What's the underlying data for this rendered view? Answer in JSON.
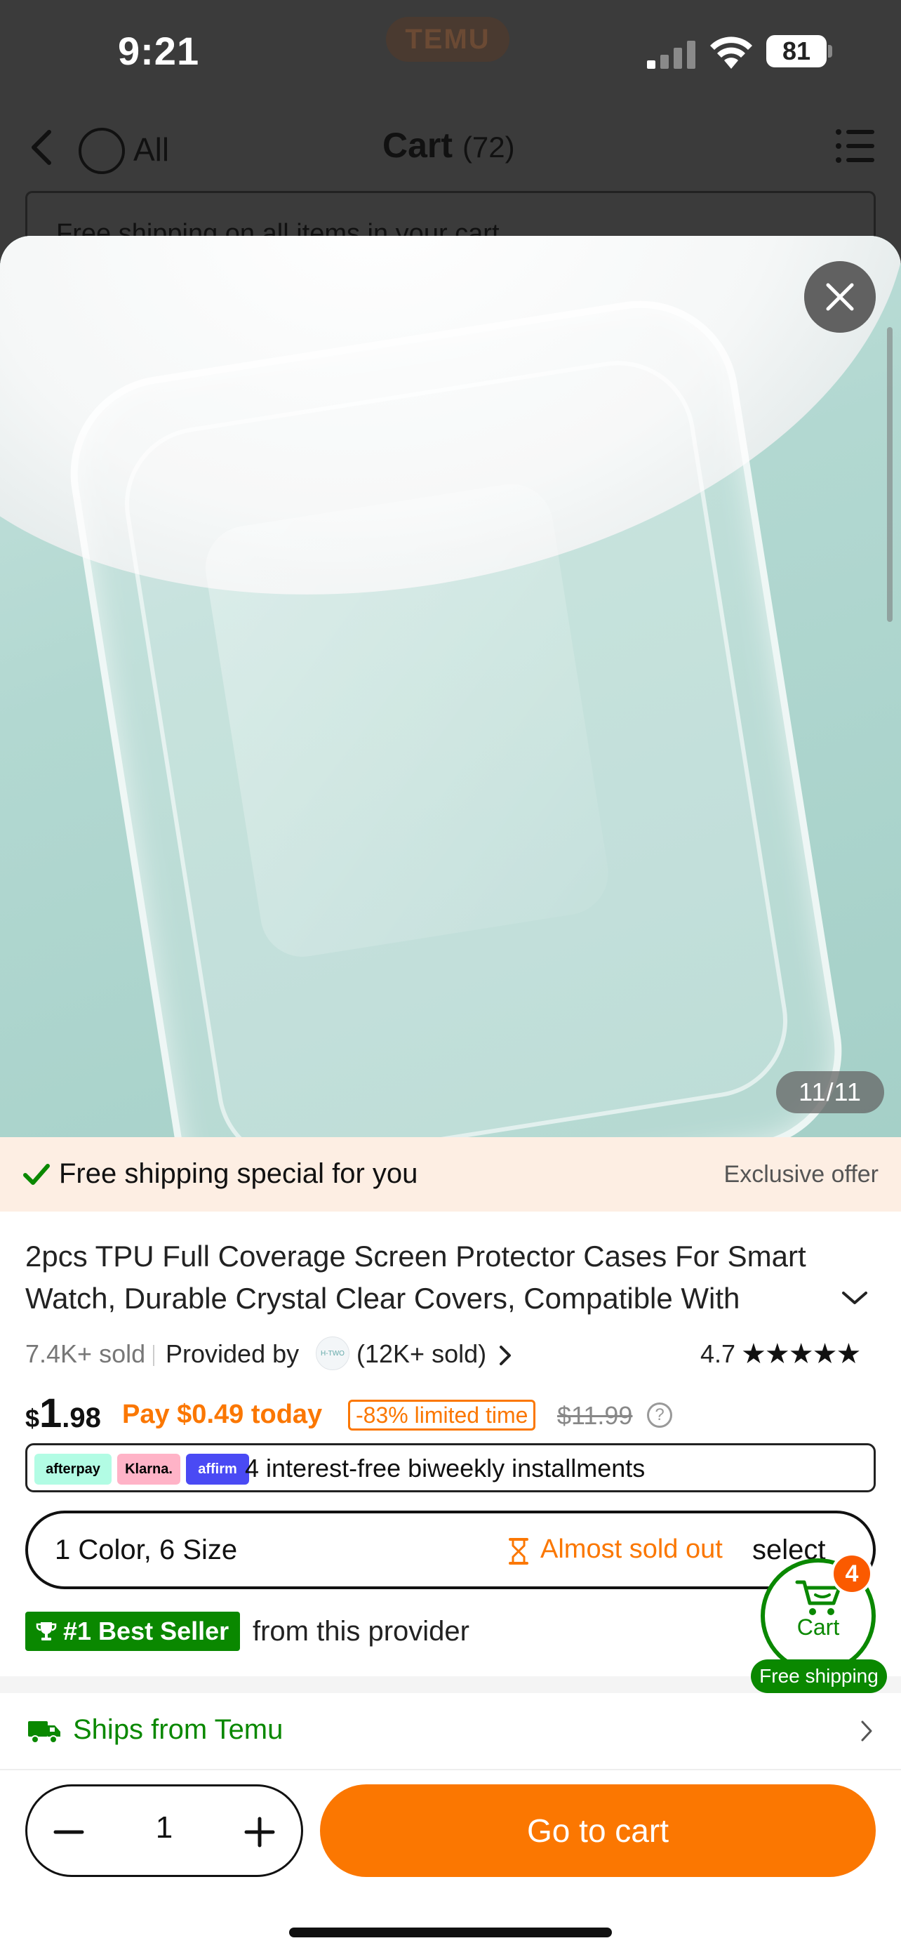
{
  "status_bar": {
    "time": "9:21",
    "center_logo": "TEMU",
    "battery_level": "81",
    "icons": [
      "signal-icon",
      "wifi-icon",
      "battery-icon"
    ]
  },
  "nav": {
    "select_all_label": "All",
    "title": "Cart",
    "count": "(72)",
    "icons": [
      "back-icon",
      "menu-icon"
    ]
  },
  "background_banner": {
    "text": "Free shipping on all items in your cart"
  },
  "product": {
    "image_counter": "11/11",
    "offer_text": "Free shipping special for you",
    "offer_right": "Exclusive offer",
    "title": "2pcs TPU Full Coverage Screen Protector Cases For Smart Watch, Durable Crystal Clear Covers, Compatible With iWatch",
    "sold": "7.4K+ sold",
    "provided_by": "Provided by",
    "seller_logo_text": "H-TWO",
    "seller_sold": "(12K+ sold)",
    "rating": "4.7",
    "rating_stars": 4.7,
    "price_currency": "$",
    "price_int": "1",
    "price_dec": ".98",
    "pay_today": "Pay $0.49 today",
    "discount_badge": "-83% limited time",
    "old_price": "$11.99",
    "help_symbol": "?",
    "installments": {
      "afterpay": "afterpay",
      "klarna": "Klarna.",
      "affirm": "affirm",
      "text": "4 interest-free biweekly installments"
    },
    "sku": {
      "summary": "1 Color, 6 Size",
      "stock_warning": "Almost sold out",
      "action": "select"
    },
    "bestseller_badge": "#1 Best Seller",
    "bestseller_suffix": "from this provider",
    "ships_from": "Ships from Temu"
  },
  "floating_cart": {
    "label": "Cart",
    "badge_count": "4",
    "free_shipping": "Free shipping"
  },
  "bottom_bar": {
    "quantity": "1",
    "go_to_cart_label": "Go to cart"
  },
  "colors": {
    "accent_orange": "#fb7701",
    "green": "#0a8800",
    "offer_bg": "#fdeee3"
  }
}
